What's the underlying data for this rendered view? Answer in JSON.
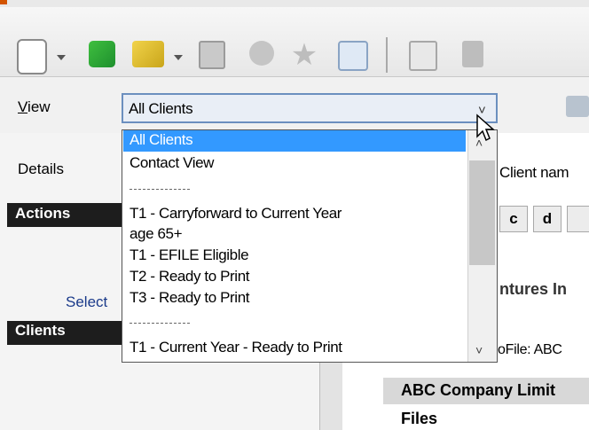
{
  "view": {
    "label_prefix": "V",
    "label_rest": "iew",
    "selected_value": "All Clients"
  },
  "dropdown": {
    "options": [
      "All Clients",
      "Contact View",
      "T1 - Carryforward to Current Year",
      "age 65+",
      "T1 - EFILE Eligible",
      "T2 - Ready to Print",
      "T3 - Ready to Print",
      "T1 - Current Year - Ready to Print"
    ]
  },
  "left_panel": {
    "details_label": "Details",
    "actions_label": "Actions",
    "select_text": "Select",
    "clients_label": "Clients"
  },
  "right_panel": {
    "client_name_label": "Client nam",
    "cells": [
      "c",
      "d"
    ],
    "company_partial": "ntures In",
    "profile_partial": "oFile: ABC",
    "company_band": "ABC Company Limit",
    "files_label": "Files"
  },
  "colors": {
    "selection": "#3399ff",
    "header_bar": "#1d1d1d",
    "combo_border": "#6b8fbf"
  },
  "icons": [
    "new-document-icon",
    "green-arrow-icon",
    "folder-icon",
    "save-icon",
    "info-icon",
    "star-icon",
    "search-icon",
    "edit-icon",
    "calculator-icon",
    "printer-icon"
  ]
}
